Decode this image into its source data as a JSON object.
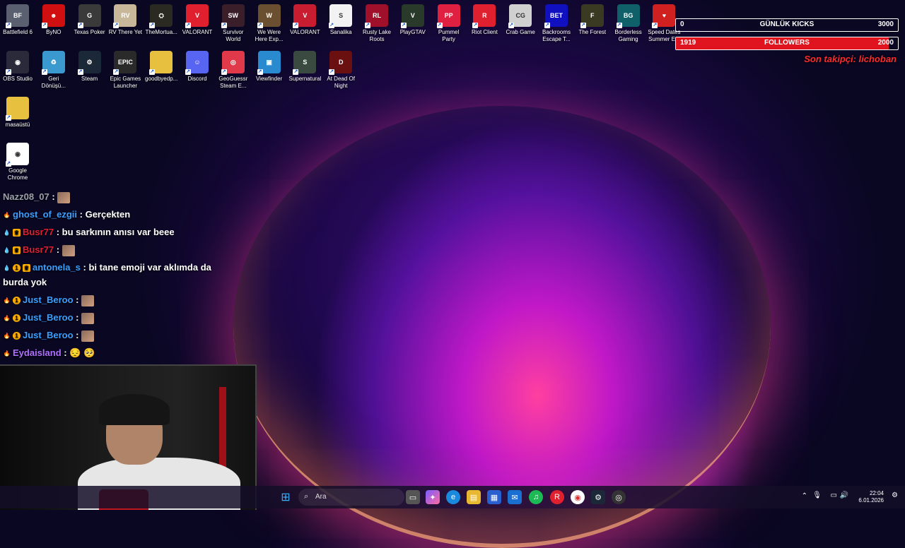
{
  "desktop": {
    "row1": [
      {
        "label": "Battlefield 6",
        "color": "#5a6070",
        "glyph": "BF"
      },
      {
        "label": "ByNO",
        "color": "#d01010",
        "glyph": "☻"
      },
      {
        "label": "Texas Poker",
        "color": "#3a3a3a",
        "glyph": "G"
      },
      {
        "label": "RV There Yet",
        "color": "#c9b79a",
        "glyph": "RV"
      },
      {
        "label": "TheMortua...",
        "color": "#2a2a22",
        "glyph": "⛭"
      },
      {
        "label": "VALORANT",
        "color": "#e0202e",
        "glyph": "V"
      },
      {
        "label": "Survivor World",
        "color": "#3a1e2a",
        "glyph": "SW"
      },
      {
        "label": "We Were Here Exp...",
        "color": "#6a5030",
        "glyph": "W"
      },
      {
        "label": "VALORANT",
        "color": "#c81c30",
        "glyph": "V"
      },
      {
        "label": "Sanalika",
        "color": "#f2f2f2",
        "glyph": "S"
      },
      {
        "label": "Rusty Lake Roots",
        "color": "#a0102a",
        "glyph": "RL"
      },
      {
        "label": "PlayGTAV",
        "color": "#2a3a2a",
        "glyph": "V"
      },
      {
        "label": "Pummel Party",
        "color": "#e02040",
        "glyph": "PP"
      },
      {
        "label": "Riot Client",
        "color": "#e0202e",
        "glyph": "R"
      },
      {
        "label": "Crab Game",
        "color": "#d0d0d0",
        "glyph": "CG"
      },
      {
        "label": "Backrooms Escape T...",
        "color": "#1010c0",
        "glyph": "BET"
      },
      {
        "label": "The Forest",
        "color": "#3a3a22",
        "glyph": "F"
      },
      {
        "label": "Borderless Gaming",
        "color": "#10606a",
        "glyph": "BG"
      },
      {
        "label": "Speed Dates Summer E...",
        "color": "#d02020",
        "glyph": "♥"
      }
    ],
    "row2": [
      {
        "label": "OBS Studio",
        "color": "#2a2a3a",
        "glyph": "◉"
      },
      {
        "label": "Geri Dönüşü...",
        "color": "#3a9ad0",
        "glyph": "♻"
      },
      {
        "label": "Steam",
        "color": "#1b2838",
        "glyph": "⚙"
      },
      {
        "label": "Epic Games Launcher",
        "color": "#2a2a2a",
        "glyph": "EPIC"
      },
      {
        "label": "goodbyedp...",
        "color": "#e8c040",
        "glyph": ""
      },
      {
        "label": "Discord",
        "color": "#5865f2",
        "glyph": "☺"
      },
      {
        "label": "GeoGuessr Steam E...",
        "color": "#e03a4a",
        "glyph": "◎"
      },
      {
        "label": "Viewfinder",
        "color": "#2a8ad0",
        "glyph": "▣"
      },
      {
        "label": "Supernatural",
        "color": "#3a4a40",
        "glyph": "S"
      },
      {
        "label": "At Dead Of Night",
        "color": "#6a1010",
        "glyph": "D"
      }
    ],
    "col1_extra": [
      {
        "label": "masaüstü",
        "color": "#e8c040",
        "glyph": ""
      },
      {
        "label": "Google Chrome",
        "color": "#ffffff",
        "glyph": "◉"
      }
    ]
  },
  "overlay": {
    "kicks": {
      "left": "0",
      "title": "GÜNLÜK KICKS",
      "right": "3000",
      "fill_fraction": 0
    },
    "followers": {
      "left": "1919",
      "title": "FOLLOWERS",
      "right": "2000",
      "fill_fraction": 0.96
    },
    "last_follower": "Son takipçi: lichoban"
  },
  "chat": [
    {
      "user": "Nazz08_07",
      "text": "",
      "color": "#9aa0a8",
      "badges": [],
      "emote": true
    },
    {
      "user": "ghost_of_ezgii",
      "text": "Gerçekten",
      "color": "#3aa0ff",
      "badges": [
        "fire"
      ],
      "emote": false
    },
    {
      "user": "Busr77",
      "text": "bu sarkının anısı var beee",
      "color": "#e02030",
      "badges": [
        "drop",
        "crown"
      ],
      "emote": false
    },
    {
      "user": "Busr77",
      "text": "",
      "color": "#e02030",
      "badges": [
        "drop",
        "crown"
      ],
      "emote": true
    },
    {
      "user": "antonela_s",
      "text": "bi tane emoji var aklımda da burda yok",
      "color": "#3aa0ff",
      "badges": [
        "drop",
        "one",
        "crown"
      ],
      "emote": false
    },
    {
      "user": "Just_Beroo",
      "text": "",
      "color": "#3aa0ff",
      "badges": [
        "fire",
        "one"
      ],
      "emote": true
    },
    {
      "user": "Just_Beroo",
      "text": "",
      "color": "#3aa0ff",
      "badges": [
        "fire",
        "one"
      ],
      "emote": true
    },
    {
      "user": "Just_Beroo",
      "text": "",
      "color": "#3aa0ff",
      "badges": [
        "fire",
        "one"
      ],
      "emote": true
    },
    {
      "user": "Eydaisland",
      "text": "😔 🥺",
      "color": "#b070ff",
      "badges": [
        "fire"
      ],
      "emote": false
    }
  ],
  "taskbar": {
    "search_placeholder": "Ara",
    "time": "22:04",
    "date": "6.01.2026"
  }
}
